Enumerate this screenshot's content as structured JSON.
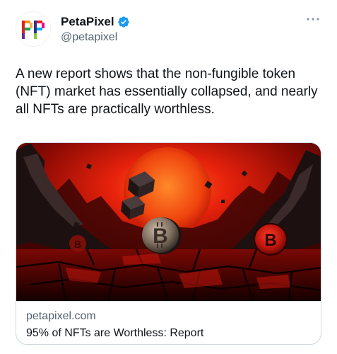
{
  "author": {
    "display_name": "PetaPixel",
    "handle": "@petapixel",
    "verified": true
  },
  "icons": {
    "avatar": "petapixel-logo",
    "verified": "verified-badge-icon",
    "more": "more-options-icon"
  },
  "tweet": {
    "text": "A new report shows that the non-fungible token (NFT) market has essentially collapsed, and nearly all NFTs are practically worthless."
  },
  "card": {
    "image_description": "red apocalyptic landscape with floating cubes and bitcoin coins",
    "domain": "petapixel.com",
    "title": "95% of NFTs are Worthless: Report"
  },
  "colors": {
    "verified_blue": "#1d9bf0",
    "text_primary": "#0f1419",
    "text_secondary": "#536471",
    "border": "#cfd9de"
  }
}
